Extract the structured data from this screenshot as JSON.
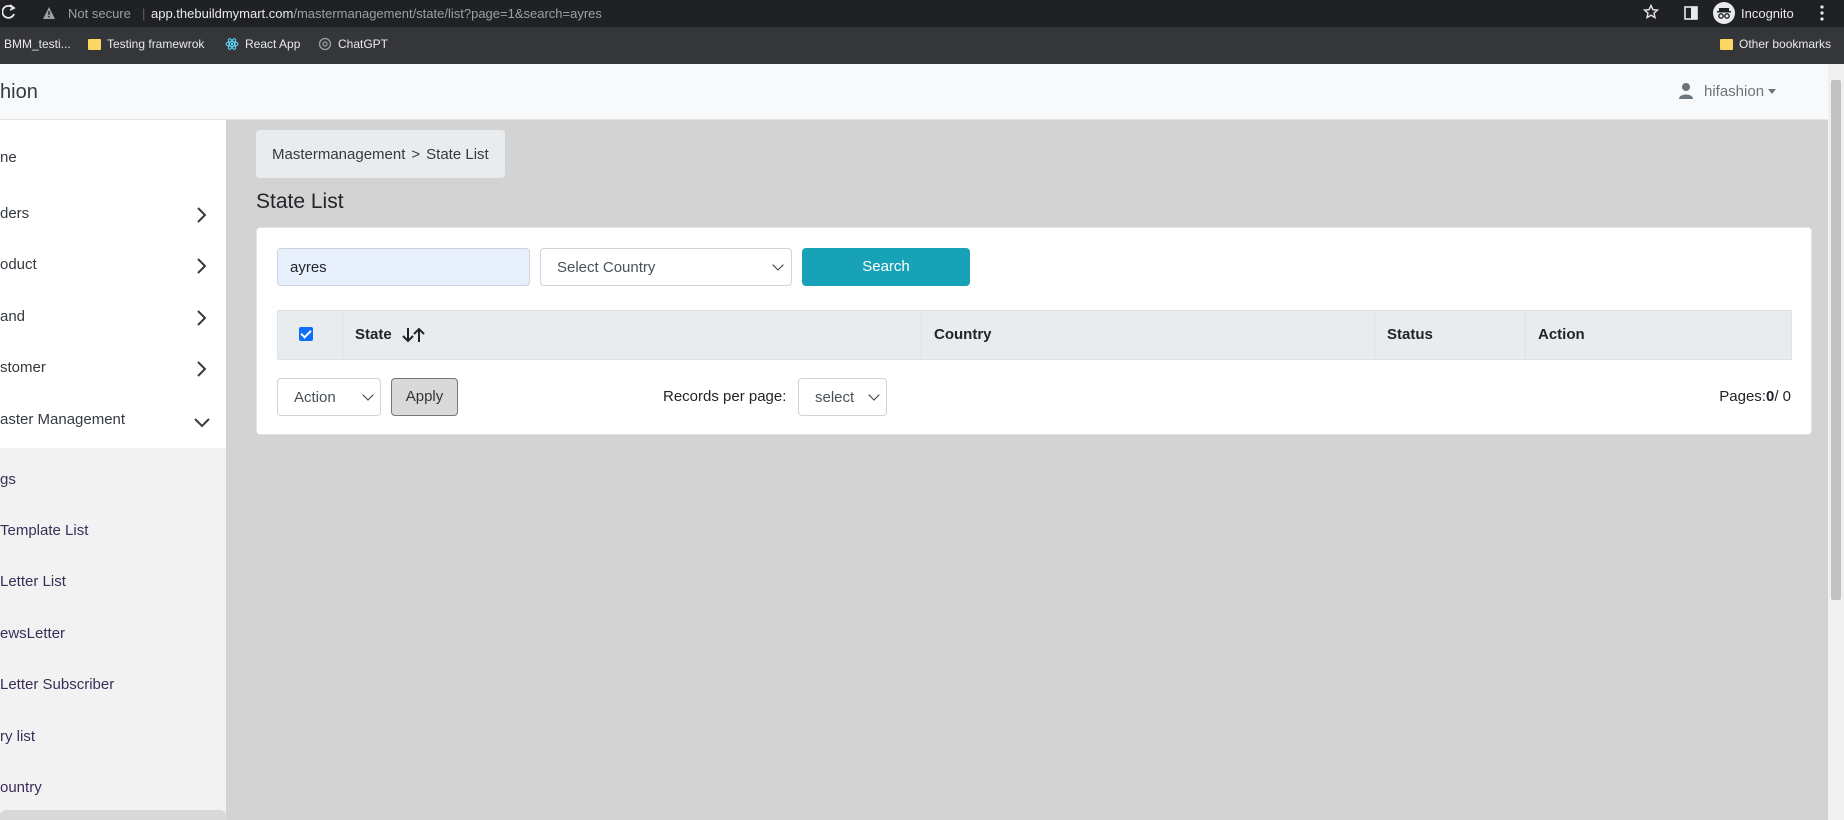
{
  "browser": {
    "not_secure": "Not secure",
    "url_host": "app.thebuildmymart.com",
    "url_path": "/mastermanagement/state/list?page=1&search=ayres",
    "incognito_label": "Incognito"
  },
  "bookmarks": {
    "items": [
      {
        "label": "BMM_testi...",
        "icon": "folder-icon"
      },
      {
        "label": "Testing framewrok",
        "icon": "folder-icon"
      },
      {
        "label": "React App",
        "icon": "react-icon"
      },
      {
        "label": "ChatGPT",
        "icon": "chatgpt-icon"
      }
    ],
    "other": "Other bookmarks"
  },
  "header": {
    "brand": "hion",
    "user": "hifashion"
  },
  "sidebar": {
    "items": [
      {
        "label": "ne",
        "chevron": null
      },
      {
        "label": "ders",
        "chevron": "right"
      },
      {
        "label": "oduct",
        "chevron": "right"
      },
      {
        "label": "and",
        "chevron": "right"
      },
      {
        "label": "stomer",
        "chevron": "right"
      },
      {
        "label": "aster Management",
        "chevron": "down"
      }
    ],
    "submenu": [
      {
        "label": "gs"
      },
      {
        "label": "Template List"
      },
      {
        "label": "Letter List"
      },
      {
        "label": "ewsLetter"
      },
      {
        "label": "Letter Subscriber"
      },
      {
        "label": "ry list"
      },
      {
        "label": "ountry"
      }
    ]
  },
  "main": {
    "breadcrumb": {
      "parent": "Mastermanagement",
      "separator": ">",
      "current": "State List"
    },
    "title": "State List",
    "search": {
      "value": "ayres"
    },
    "country_select": {
      "selected": "Select Country"
    },
    "search_button": "Search",
    "table": {
      "columns": [
        "State",
        "Country",
        "Status",
        "Action"
      ],
      "select_all_checked": true
    },
    "bulk_action": {
      "selected": "Action"
    },
    "apply_button": "Apply",
    "records_per_page": {
      "label": "Records per page:",
      "selected": "select"
    },
    "pages": {
      "label": "Pages:",
      "current": "0",
      "total": "/ 0"
    }
  },
  "colors": {
    "primary_button": "#17a2b8",
    "page_background": "#d3d3d3",
    "checkbox": "#0d6efd"
  }
}
